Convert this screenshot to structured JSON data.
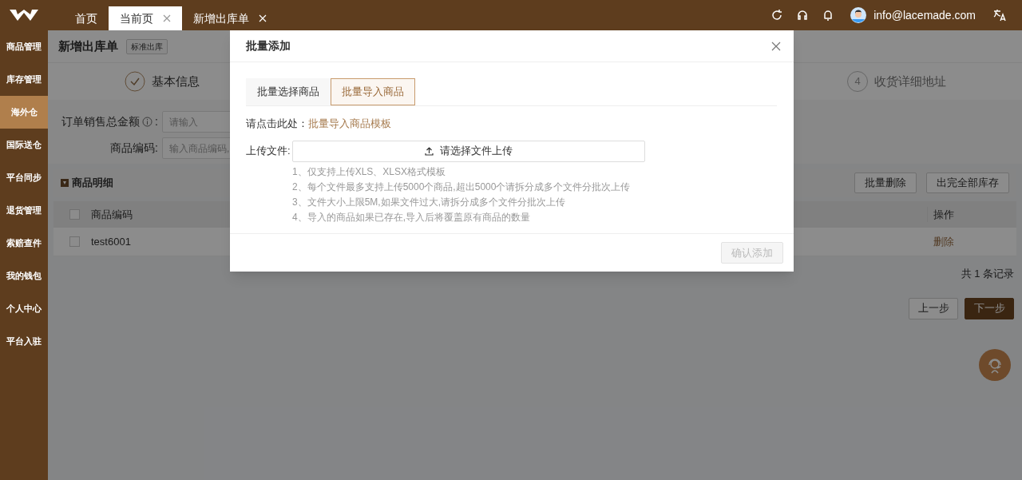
{
  "top_tabs": [
    {
      "label": "首页",
      "selected": false,
      "closable": false
    },
    {
      "label": "当前页",
      "selected": true,
      "closable": true
    },
    {
      "label": "新增出库单",
      "selected": false,
      "closable": true
    }
  ],
  "user": {
    "email": "info@lacemade.com"
  },
  "sidebar": [
    {
      "label": "商品管理",
      "selected": false
    },
    {
      "label": "库存管理",
      "selected": false
    },
    {
      "label": "海外仓",
      "selected": true
    },
    {
      "label": "国际送仓",
      "selected": false
    },
    {
      "label": "平台同步",
      "selected": false
    },
    {
      "label": "退货管理",
      "selected": false
    },
    {
      "label": "索赔查件",
      "selected": false
    },
    {
      "label": "我的钱包",
      "selected": false
    },
    {
      "label": "个人中心",
      "selected": false
    },
    {
      "label": "平台入驻",
      "selected": false
    }
  ],
  "page": {
    "title": "新增出库单",
    "tag": "标准出库"
  },
  "steps": [
    {
      "label": "基本信息",
      "done": true
    },
    {
      "number": "4",
      "label": "收货详细地址",
      "done": false
    }
  ],
  "form": [
    {
      "label": "订单销售总金额",
      "info": true,
      "colon": ":",
      "placeholder": "请输入"
    },
    {
      "label": "商品编码:",
      "info": false,
      "placeholder": "输入商品编码,"
    }
  ],
  "section": {
    "title": "商品明细",
    "buttons": [
      "批量删除",
      "出完全部库存"
    ]
  },
  "table": {
    "header_checked": false,
    "columns": [
      "商品编码",
      "操作"
    ],
    "rows": [
      {
        "checked": false,
        "code": "test6001",
        "action": "删除"
      }
    ]
  },
  "record_count": "共 1 条记录",
  "nav_buttons": [
    {
      "label": "上一步",
      "kind": "default"
    },
    {
      "label": "下一步",
      "kind": "primary"
    }
  ],
  "dialog": {
    "title": "批量添加",
    "tabs": [
      {
        "label": "批量选择商品",
        "selected": false
      },
      {
        "label": "批量导入商品",
        "selected": true
      }
    ],
    "template_prompt": "请点击此处：",
    "template_link": "批量导入商品模板",
    "upload_label": "上传文件:",
    "upload_button": "请选择文件上传",
    "notes": [
      "1、仅支持上传XLS、XLSX格式模板",
      "2、每个文件最多支持上传5000个商品,超出5000个请拆分成多个文件分批次上传",
      "3、文件大小上限5M,如果文件过大,请拆分成多个文件分批次上传",
      "4、导入的商品如果已存在,导入后将覆盖原有商品的数量"
    ],
    "confirm": {
      "label": "确认添加",
      "disabled": true
    }
  }
}
